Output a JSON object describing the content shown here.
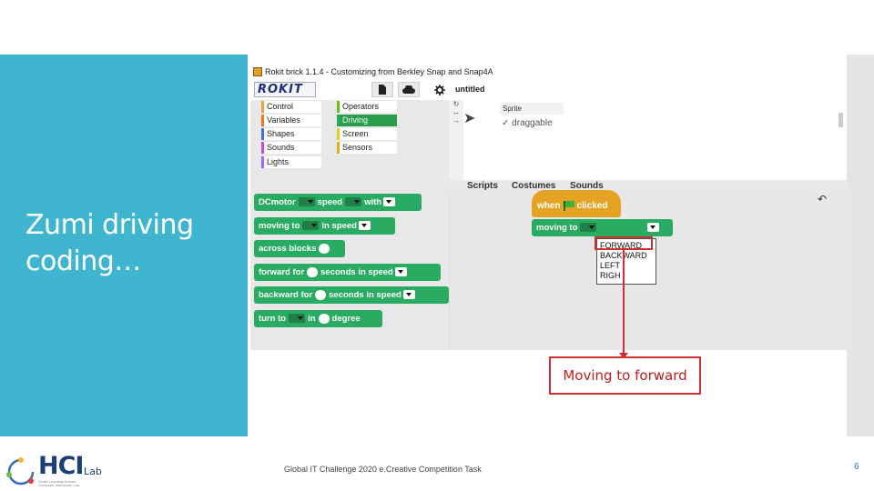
{
  "slide": {
    "title": "Zumi driving coding…",
    "footer": "Global IT Challenge 2020 e.Creative Competition Task",
    "page_number": "6",
    "callout": "Moving to forward",
    "colors": {
      "side_panel": "#3fb5cf",
      "callout": "#d0312d"
    }
  },
  "logo": {
    "text": "HCI",
    "suffix": "Lab",
    "tagline": "Smart Learning Human-Computer Interaction Lab"
  },
  "app": {
    "window_title": "Rokit brick 1.1.4 - Customizing from Berkley Snap and Snap4A",
    "logo_text": "ROKIT",
    "project_name": "untitled",
    "toolbar_icons": [
      "file-icon",
      "cloud-icon",
      "gear-icon"
    ],
    "categories": [
      {
        "label": "Control",
        "color": "#e6a33c"
      },
      {
        "label": "Operators",
        "color": "#62c213"
      },
      {
        "label": "Variables",
        "color": "#f3761d"
      },
      {
        "label": "Driving",
        "color": "#2aab62"
      },
      {
        "label": "Shapes",
        "color": "#4a6cd4"
      },
      {
        "label": "Screen",
        "color": "#f2c71c"
      },
      {
        "label": "Sounds",
        "color": "#cf4ad9"
      },
      {
        "label": "Sensors",
        "color": "#f2a71c"
      },
      {
        "label": "Lights",
        "color": "#9966ff"
      }
    ],
    "selected_category": "Driving",
    "sprite": {
      "name": "Sprite",
      "draggable_label": "draggable",
      "draggable_checked": true
    },
    "tabs": [
      "Scripts",
      "Costumes",
      "Sounds"
    ],
    "palette_blocks": {
      "dcmotor": {
        "a": "DCmotor",
        "b": "speed",
        "c": "with"
      },
      "moving": {
        "a": "moving to",
        "b": "in speed"
      },
      "across": {
        "a": "across blocks"
      },
      "forward": {
        "a": "forward for",
        "b": "seconds in speed"
      },
      "backward": {
        "a": "backward for",
        "b": "seconds in speed"
      },
      "turn": {
        "a": "turn to",
        "b": "in",
        "c": "degree"
      }
    },
    "script": {
      "hat_when": "when",
      "hat_clicked": "clicked",
      "block_label": "moving to",
      "dropdown_options": [
        "FORWARD",
        "BACKWARD",
        "LEFT",
        "RIGH"
      ],
      "selected_option": "FORWARD"
    }
  }
}
